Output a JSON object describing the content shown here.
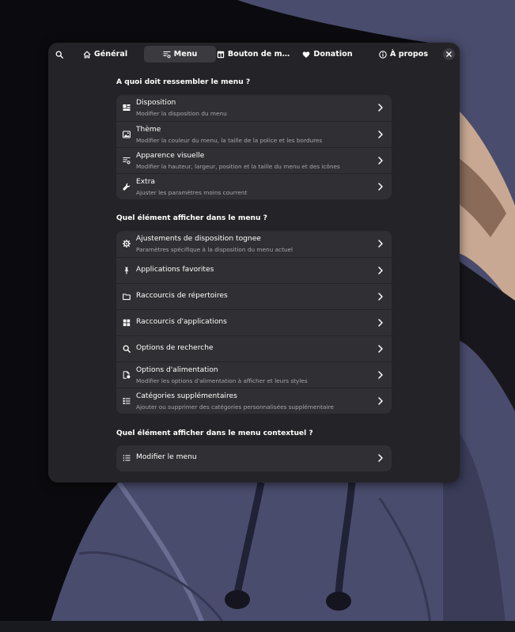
{
  "colors": {
    "window_bg": "#242428",
    "row_bg": "#303034",
    "active_tab_bg": "#3a3a3f",
    "text": "#ffffff",
    "subtext": "#a7a7ac"
  },
  "headerbar": {
    "search_icon": "search-icon",
    "tabs": [
      {
        "label": "Général",
        "icon": "home-icon",
        "active": false
      },
      {
        "label": "Menu",
        "icon": "menu-settings-icon",
        "active": true
      },
      {
        "label": "Bouton de m…",
        "icon": "layout-icon",
        "active": false
      },
      {
        "label": "Donation",
        "icon": "heart-icon",
        "active": false
      },
      {
        "label": "À propos",
        "icon": "info-icon",
        "active": false
      }
    ],
    "close_icon": "close-icon"
  },
  "sections": [
    {
      "title": "A quoi doit ressembler le menu ?",
      "rows": [
        {
          "title": "Disposition",
          "subtitle": "Modifier la disposition du menu",
          "icon": "disposition-icon"
        },
        {
          "title": "Thème",
          "subtitle": "Modifier la couleur du menu, la taille de la police et les bordures",
          "icon": "theme-icon"
        },
        {
          "title": "Apparence visuelle",
          "subtitle": "Modifier la hauteur, largeur, position et la taille du menu et des icônes",
          "icon": "appearance-icon"
        },
        {
          "title": "Extra",
          "subtitle": "Ajuster les paramètres moins courrent",
          "icon": "wrench-icon"
        }
      ]
    },
    {
      "title": "Quel élément afficher dans le menu ?",
      "rows": [
        {
          "title": "Ajustements de disposition tognee",
          "subtitle": "Paramètres spécifique à la disposition du menu actuel",
          "icon": "gear-icon"
        },
        {
          "title": "Applications favorites",
          "subtitle": "",
          "icon": "pin-icon"
        },
        {
          "title": "Raccourcis de répertoires",
          "subtitle": "",
          "icon": "folder-icon"
        },
        {
          "title": "Raccourcis d'applications",
          "subtitle": "",
          "icon": "app-grid-icon"
        },
        {
          "title": "Options de recherche",
          "subtitle": "",
          "icon": "search-icon"
        },
        {
          "title": "Options d'alimentation",
          "subtitle": "Modifier les options d'alimentation à afficher et leurs styles",
          "icon": "power-icon"
        },
        {
          "title": "Catégories supplémentaires",
          "subtitle": "Ajouter ou supprimer des catégories personnalisées supplémentaire",
          "icon": "categories-icon"
        }
      ]
    },
    {
      "title": "Quel élément afficher dans le menu contextuel ?",
      "rows": [
        {
          "title": "Modifier le menu",
          "subtitle": "",
          "icon": "list-icon"
        }
      ]
    }
  ]
}
